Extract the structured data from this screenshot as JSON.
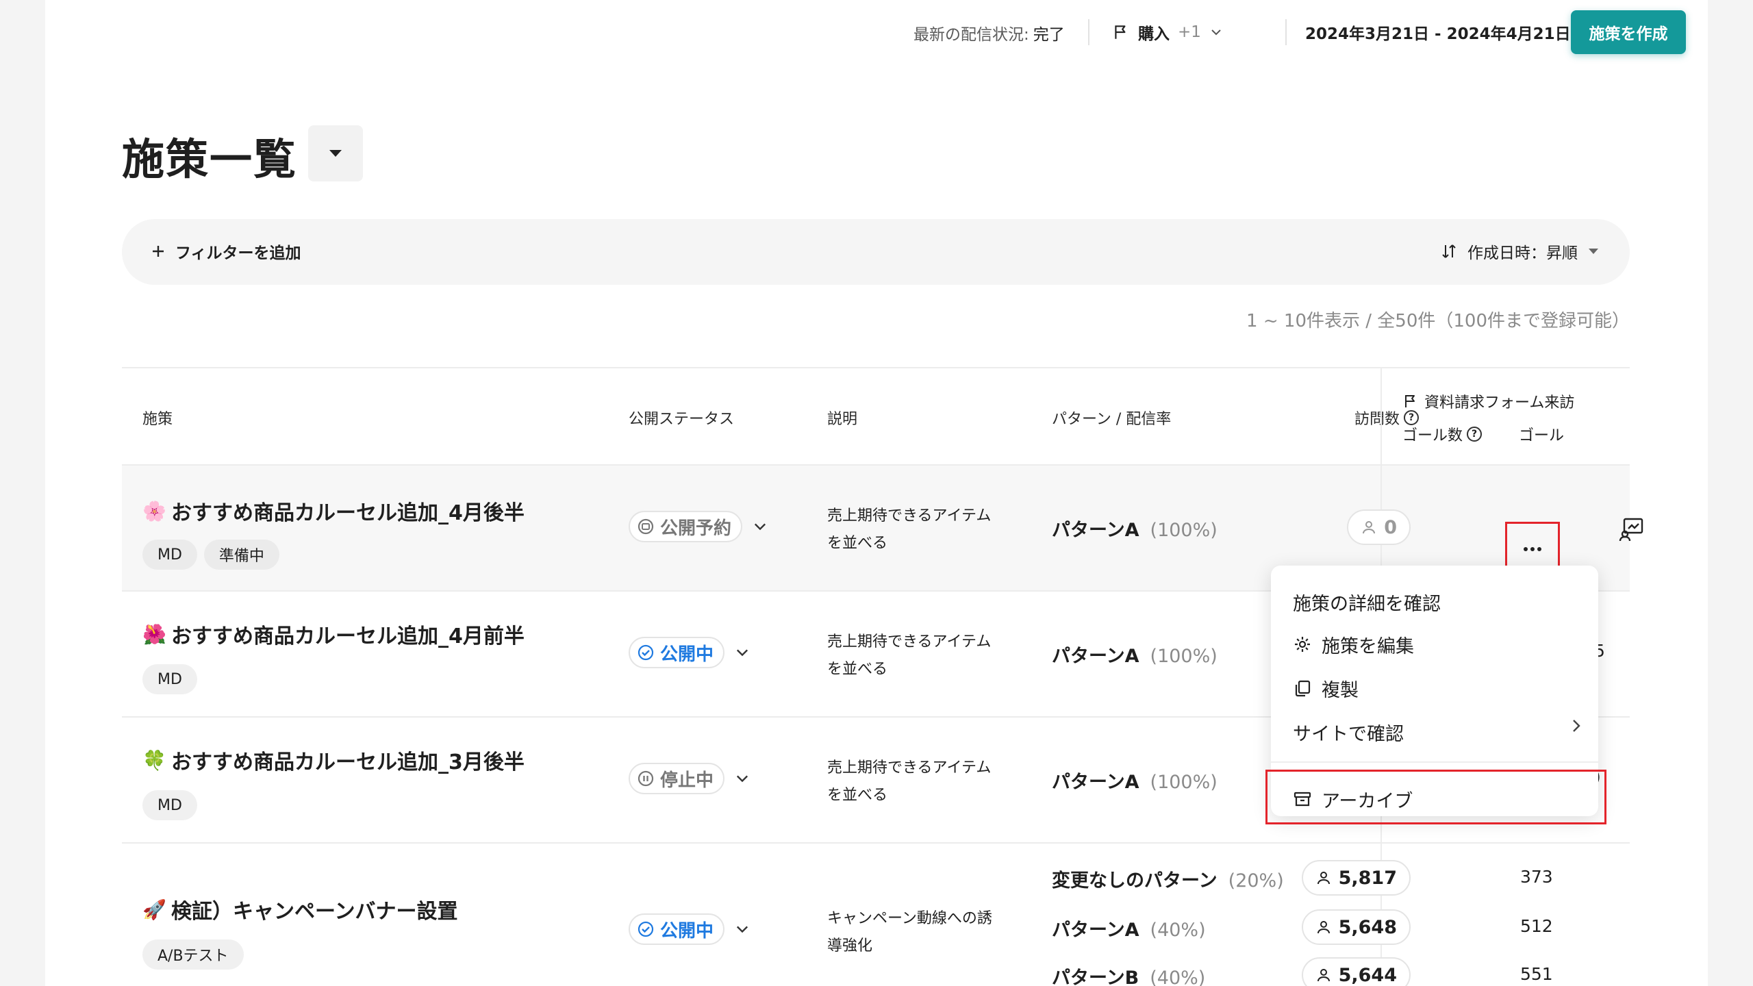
{
  "topbar": {
    "status_label": "最新の配信状況:",
    "status_value": "完了",
    "goal_label": "購入",
    "goal_extra": "+1",
    "date_range": "2024年3月21日 - 2024年4月21日",
    "create_button": "施策を作成"
  },
  "page": {
    "title": "施策一覧"
  },
  "filters": {
    "add_filter": "フィルターを追加",
    "sort_label": "作成日時：昇順",
    "count_text": "1 ~ 10件表示 / 全50件（100件まで登録可能）"
  },
  "table": {
    "headers": {
      "name": "施策",
      "status": "公開ステータス",
      "description": "説明",
      "pattern": "パターン / 配信率",
      "visits": "訪問数",
      "goal_title": "資料請求フォーム来訪",
      "goal_count": "ゴール数",
      "goal_rate": "ゴール"
    },
    "rows": [
      {
        "emoji": "🌸",
        "name": "おすすめ商品カルーセル追加_4月後半",
        "tags": [
          "MD",
          "準備中"
        ],
        "status": "公開予約",
        "description_line1": "売上期待できるアイテム",
        "description_line2": "を並べる",
        "pattern": "パターンA",
        "pattern_pct": "(100%)",
        "visits": "0"
      },
      {
        "emoji": "🌺",
        "name": "おすすめ商品カルーセル追加_4月前半",
        "tags": [
          "MD"
        ],
        "status": "公開中",
        "description_line1": "売上期待できるアイテム",
        "description_line2": "を並べる",
        "pattern": "パターンA",
        "pattern_pct": "(100%)",
        "goal_partial": "5"
      },
      {
        "emoji": "🍀",
        "name": "おすすめ商品カルーセル追加_3月後半",
        "tags": [
          "MD"
        ],
        "status": "停止中",
        "description_line1": "売上期待できるアイテム",
        "description_line2": "を並べる",
        "pattern": "パターンA",
        "pattern_pct": "(100%)",
        "goal_partial": ")"
      },
      {
        "emoji": "🚀",
        "name": "検証）キャンペーンバナー設置",
        "tags": [
          "A/Bテスト"
        ],
        "status": "公開中",
        "description_line1": "キャンペーン動線への誘",
        "description_line2": "導強化",
        "patterns": [
          {
            "name": "変更なしのパターン",
            "pct": "(20%)",
            "visits": "5,817",
            "goals": "373"
          },
          {
            "name": "パターンA",
            "pct": "(40%)",
            "visits": "5,648",
            "goals": "512"
          },
          {
            "name": "パターンB",
            "pct": "(40%)",
            "visits": "5,644",
            "goals": "551"
          }
        ]
      }
    ]
  },
  "menu": {
    "items": [
      {
        "label": "施策の詳細を確認"
      },
      {
        "label": "施策を編集",
        "icon": "gear-icon"
      },
      {
        "label": "複製",
        "icon": "copy-icon"
      },
      {
        "label": "サイトで確認",
        "icon": "chevron-right-icon"
      },
      {
        "label": "アーカイブ",
        "icon": "archive-icon"
      }
    ]
  },
  "colors": {
    "accent": "#14999a",
    "live_blue": "#1f7ae0",
    "highlight_red": "#e3242b"
  }
}
